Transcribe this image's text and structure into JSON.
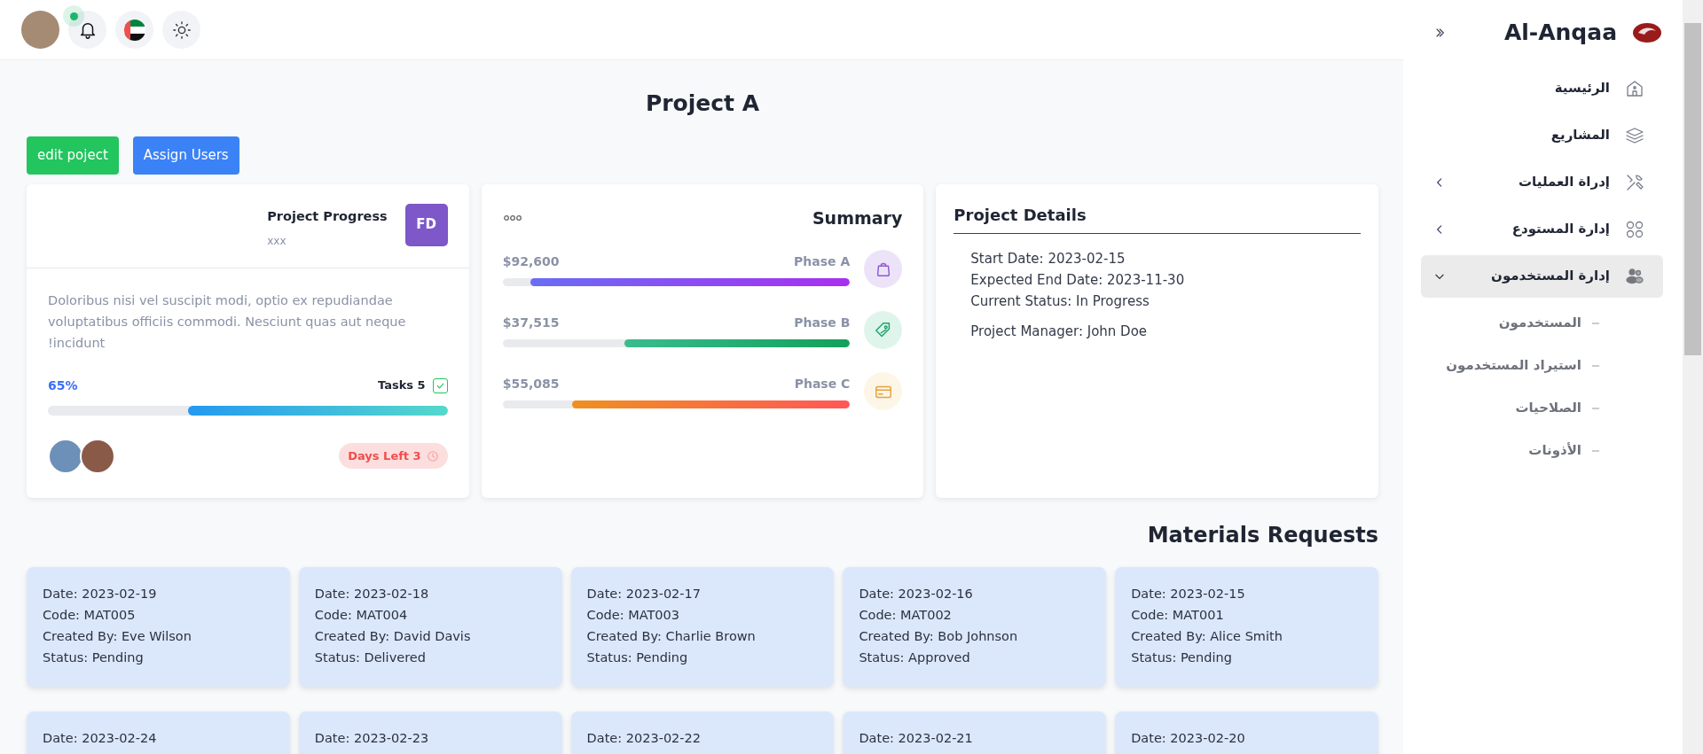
{
  "header": {
    "has_notification": true
  },
  "project": {
    "title": "Project A",
    "actions": [
      "edit poject",
      "Assign Users"
    ]
  },
  "progress_card": {
    "title": "Project Progress",
    "subtitle": "xxx",
    "badge": "FD",
    "description": "Doloribus nisi vel suscipit modi, optio ex repudiandae voluptatibus officiis commodi. Nesciunt quas aut neque !incidunt",
    "percent": "65%",
    "level": 0.65,
    "tasks": "Tasks 5",
    "tasks_checked": true,
    "days_left": "Days Left 3"
  },
  "summary": {
    "title": "Summary",
    "phases": [
      {
        "amount": "$92,600",
        "label": "Phase A",
        "level": 0.92,
        "color": "#8e5bd8"
      },
      {
        "amount": "$37,515",
        "label": "Phase B",
        "level": 0.65,
        "color": "#1fa56a"
      },
      {
        "amount": "$55,085",
        "label": "Phase C",
        "level": 0.8,
        "color": "#e8a040"
      }
    ]
  },
  "details": {
    "title": "Project Details",
    "lines": [
      "Start Date: 2023-02-15",
      "Expected End Date: 2023-11-30",
      "Current Status: In Progress"
    ],
    "manager": "Project Manager: John Doe"
  },
  "materials": {
    "title": "Materials Requests",
    "requests": [
      {
        "lines": [
          "Date: 2023-02-19",
          "Code: MAT005",
          "Created By: Eve Wilson",
          "Status: Pending"
        ]
      },
      {
        "lines": [
          "Date: 2023-02-18",
          "Code: MAT004",
          "Created By: David Davis",
          "Status: Delivered"
        ]
      },
      {
        "lines": [
          "Date: 2023-02-17",
          "Code: MAT003",
          "Created By: Charlie Brown",
          "Status: Pending"
        ]
      },
      {
        "lines": [
          "Date: 2023-02-16",
          "Code: MAT002",
          "Created By: Bob Johnson",
          "Status: Approved"
        ]
      },
      {
        "lines": [
          "Date: 2023-02-15",
          "Code: MAT001",
          "Created By: Alice Smith",
          "Status: Pending"
        ]
      },
      {
        "lines": [
          "Date: 2023-02-24"
        ]
      },
      {
        "lines": [
          "Date: 2023-02-23"
        ]
      },
      {
        "lines": [
          "Date: 2023-02-22"
        ]
      },
      {
        "lines": [
          "Date: 2023-02-21"
        ]
      },
      {
        "lines": [
          "Date: 2023-02-20"
        ]
      }
    ]
  },
  "sidebar": {
    "brand": "Al-Anqaa",
    "items": [
      {
        "label": "الرئيسية",
        "kind": "link",
        "selected": false
      },
      {
        "label": "المشاريع",
        "kind": "link",
        "selected": false
      },
      {
        "label": "إدراة العمليات",
        "kind": "group",
        "expanded": false,
        "selected": false
      },
      {
        "label": "إدارة المستودع",
        "kind": "group",
        "expanded": false,
        "selected": false
      },
      {
        "label": "إدارة المستخدمون",
        "kind": "group",
        "expanded": true,
        "selected": true,
        "children": [
          {
            "label": "المستخدمون"
          },
          {
            "label": "استيراد المستخدمون"
          },
          {
            "label": "الصلاحيات"
          },
          {
            "label": "الأذونات"
          }
        ]
      }
    ]
  }
}
